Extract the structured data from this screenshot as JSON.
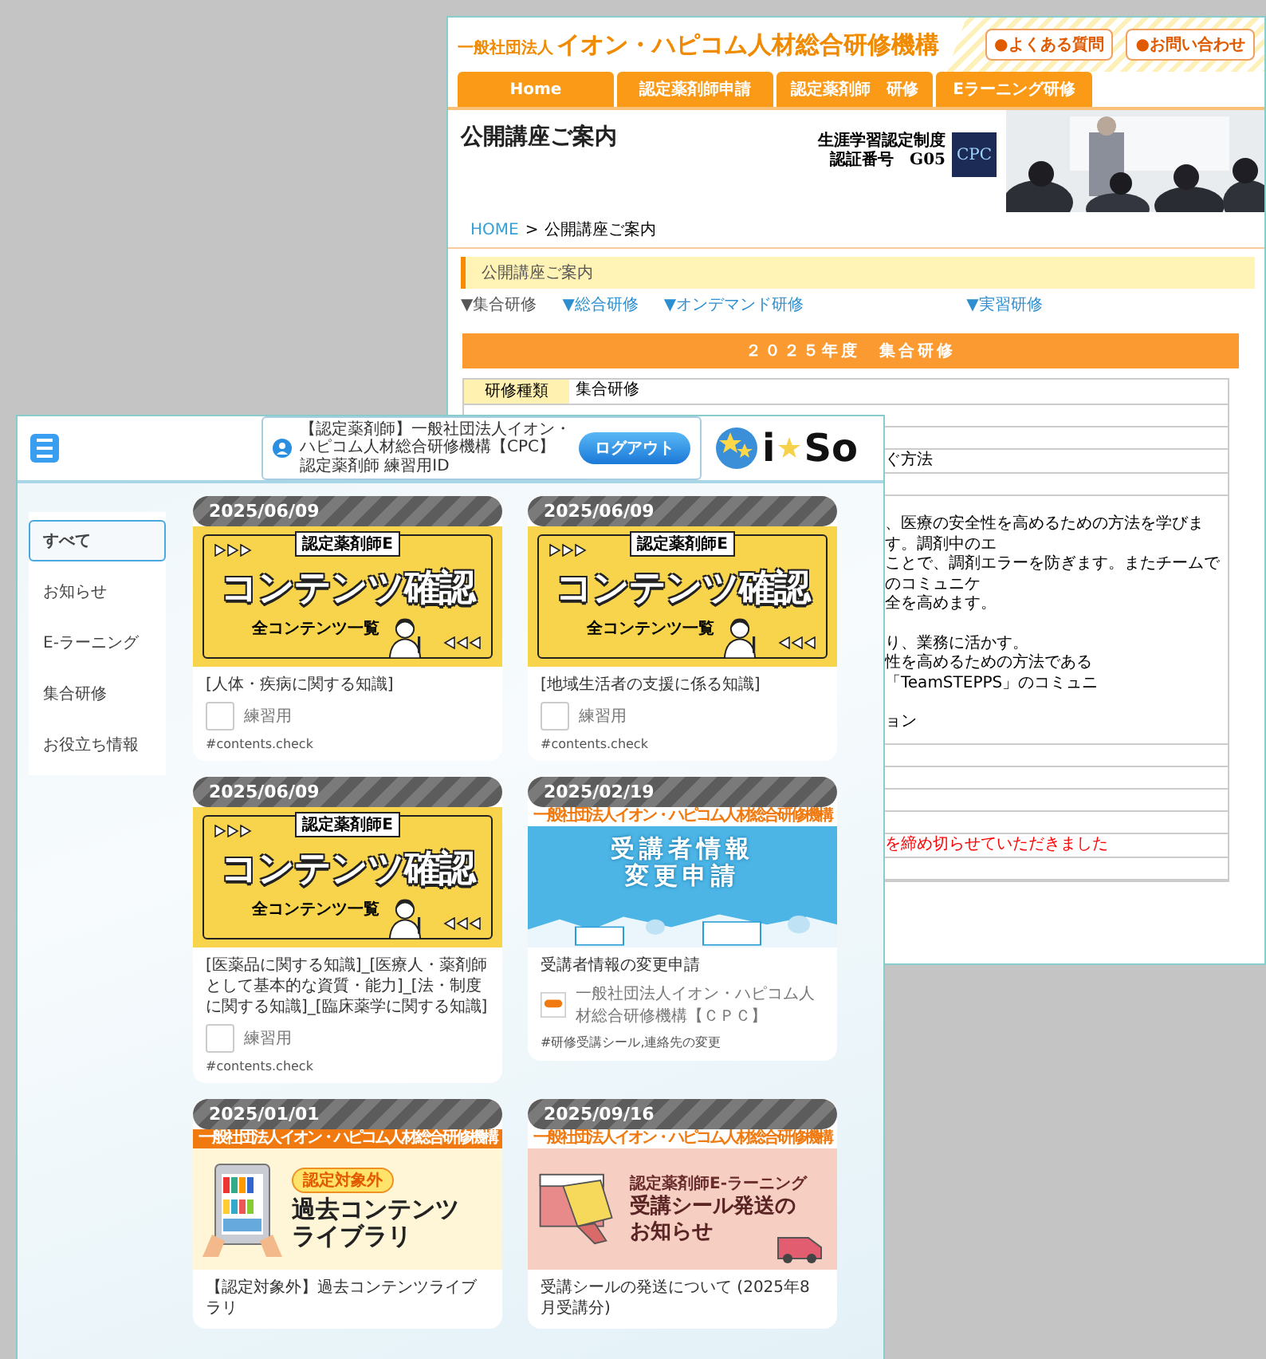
{
  "back_window": {
    "org_prefix": "一般社団法人",
    "org_name": "イオン・ハピコム人材総合研修機構",
    "header_links": [
      "●よくある質問",
      "●お問い合わせ"
    ],
    "nav_tabs": [
      "Home",
      "認定薬剤師申請",
      "認定薬剤師　研修",
      "Eラーニング研修"
    ],
    "page_title": "公開講座ご案内",
    "certification": [
      "生涯学習認定制度",
      "認証番号　G05"
    ],
    "cert_logo": "CPC",
    "breadcrumb": [
      {
        "label": "HOME",
        "link": true
      },
      {
        "label": "公開講座ご案内",
        "link": false
      }
    ],
    "breadcrumb_separator": ">",
    "section_heading": "公開講座ご案内",
    "anchor_links": [
      {
        "label": "▼集合研修",
        "selected": true
      },
      {
        "label": "▼総合研修",
        "selected": false
      },
      {
        "label": "▼オンデマンド研修",
        "selected": false
      },
      {
        "label": "▼実習研修",
        "selected": false
      }
    ],
    "year_banner": "２０２５年度　集合研修",
    "table_rows": [
      {
        "kind": "header",
        "label": "研修種類",
        "lines": [
          "集合研修"
        ]
      },
      {
        "kind": "blank"
      },
      {
        "kind": "blank"
      },
      {
        "kind": "text",
        "lines": [
          "ぐ方法"
        ]
      },
      {
        "kind": "blank"
      },
      {
        "kind": "paragraphs",
        "groups": [
          [
            "、医療の安全性を高めるための方法を学びます。調剤中のエ",
            "ことで、調剤エラーを防ぎます。またチームでのコミュニケ",
            "全を高めます。"
          ],
          [
            "り、業務に活かす。",
            "性を高めるための方法である「TeamSTEPPS」のコミュニ"
          ],
          [
            "ョン"
          ]
        ]
      },
      {
        "kind": "blank"
      },
      {
        "kind": "blank"
      },
      {
        "kind": "blank"
      },
      {
        "kind": "blank"
      },
      {
        "kind": "notice",
        "lines": [
          "を締め切らせていただきました"
        ]
      },
      {
        "kind": "blank"
      }
    ]
  },
  "front_window": {
    "user": [
      "【認定薬剤師】一般社団法人イオン・ハピコム人材総合研修機構【CPC】",
      "認定薬剤師 練習用ID"
    ],
    "logout_button": "ログアウト",
    "brand": [
      "i",
      "So"
    ],
    "sidebar": [
      {
        "label": "すべて",
        "selected": true
      },
      {
        "label": "お知らせ",
        "selected": false
      },
      {
        "label": "E-ラーニング",
        "selected": false
      },
      {
        "label": "集合研修",
        "selected": false
      },
      {
        "label": "お役立ち情報",
        "selected": false
      }
    ],
    "cards": [
      {
        "date": "2025/06/09",
        "banner": {
          "kind": "contents",
          "badge": "認定薬剤師E",
          "headline": "コンテンツ確認",
          "caption": "全コンテンツ一覧"
        },
        "title": "[人体・疾病に関する知識]",
        "author": {
          "kind": "blank",
          "name": "練習用"
        },
        "tag": "#contents.check"
      },
      {
        "date": "2025/06/09",
        "banner": {
          "kind": "contents",
          "badge": "認定薬剤師E",
          "headline": "コンテンツ確認",
          "caption": "全コンテンツ一覧"
        },
        "title": "[地域生活者の支援に係る知識]",
        "author": {
          "kind": "blank",
          "name": "練習用"
        },
        "tag": "#contents.check"
      },
      {
        "date": "2025/06/09",
        "banner": {
          "kind": "contents",
          "badge": "認定薬剤師E",
          "headline": "コンテンツ確認",
          "caption": "全コンテンツ一覧"
        },
        "title": "[医薬品に関する知識]_[医療人・薬剤師として基本的な資質・能力]_[法・制度に関する知識]_[臨床薬学に関する知識]",
        "author": {
          "kind": "blank",
          "name": "練習用"
        },
        "tag": "#contents.check"
      },
      {
        "date": "2025/02/19",
        "banner": {
          "kind": "notice",
          "strip": "一般社団法人イオン・ハピコム人材総合研修機構",
          "lines": [
            "受講者情報",
            "変更申請"
          ]
        },
        "title": "受講者情報の変更申請",
        "author": {
          "kind": "logo",
          "name": "一般社団法人イオン・ハピコム人材総合研修機構【ＣＰＣ】"
        },
        "tag": "#研修受講シール,連絡先の変更"
      },
      {
        "date": "2025/01/01",
        "banner": {
          "kind": "library",
          "strip": "一般社団法人イオン・ハピコム人材総合研修機構",
          "badge": "認定対象外",
          "lines": [
            "過去コンテンツ",
            "ライブラリ"
          ]
        },
        "title": "【認定対象外】過去コンテンツライブラリ"
      },
      {
        "date": "2025/09/16",
        "banner": {
          "kind": "mail",
          "strip": "一般社団法人イオン・ハピコム人材総合研修機構",
          "sub": "認定薬剤師E-ラーニング",
          "lines": [
            "受講シール発送の",
            "お知らせ"
          ]
        },
        "title": "受講シールの発送について (2025年8月受講分)"
      }
    ]
  }
}
